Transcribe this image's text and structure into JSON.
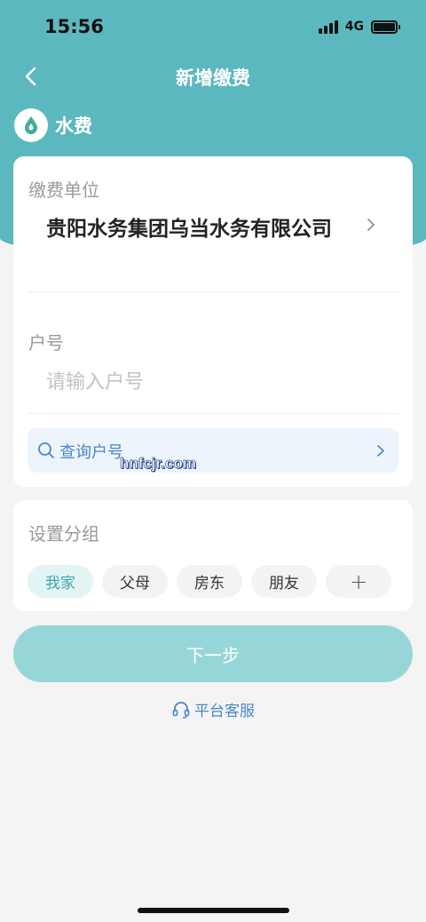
{
  "status_bar": {
    "time": "15:56",
    "network": "4G"
  },
  "nav": {
    "title": "新增缴费"
  },
  "bill_type": {
    "label": "水费",
    "icon": "water-drop-icon"
  },
  "form": {
    "unit_label": "缴费单位",
    "unit_value": "贵阳水务集团乌当水务有限公司",
    "account_label": "户号",
    "account_placeholder": "请输入户号",
    "account_value": "",
    "query_label": "查询户号",
    "watermark": "hnfcjr.com"
  },
  "group": {
    "title": "设置分组",
    "chips": [
      "我家",
      "父母",
      "房东",
      "朋友"
    ],
    "add_label": "+"
  },
  "next_button": {
    "label": "下一步"
  },
  "service": {
    "label": "平台客服"
  },
  "colors": {
    "accent": "#5cb8bf",
    "button": "#97d6d8",
    "link": "#4a86c8"
  }
}
